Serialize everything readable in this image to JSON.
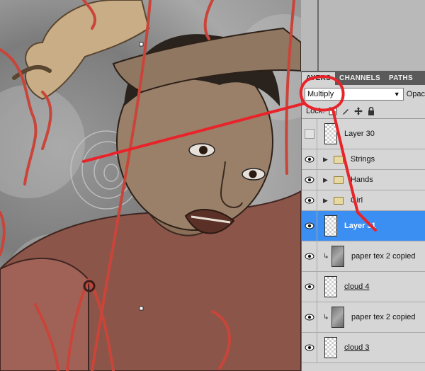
{
  "panel": {
    "tabs": [
      {
        "label": "AYERS",
        "active": true
      },
      {
        "label": "CHANNELS",
        "active": false
      },
      {
        "label": "PATHS",
        "active": false
      }
    ],
    "blend_mode": "Multiply",
    "opacity_label": "Opac",
    "lock_label": "Lock:",
    "layers": [
      {
        "name": "Layer 30",
        "visible": false,
        "kind": "layer"
      },
      {
        "name": "Strings",
        "visible": true,
        "kind": "group"
      },
      {
        "name": "Hands",
        "visible": true,
        "kind": "group"
      },
      {
        "name": "Girl",
        "visible": true,
        "kind": "group"
      },
      {
        "name": "Layer 31",
        "visible": true,
        "kind": "layer",
        "selected": true
      },
      {
        "name": "paper tex 2 copied",
        "visible": true,
        "kind": "clipped"
      },
      {
        "name": "cloud 4",
        "visible": true,
        "kind": "layer"
      },
      {
        "name": "paper tex 2 copied",
        "visible": true,
        "kind": "clipped"
      },
      {
        "name": "cloud 3",
        "visible": true,
        "kind": "layer"
      }
    ]
  },
  "colors": {
    "selection": "#3b8ff2",
    "annotation": "#e8232a",
    "string": "#c9453a"
  }
}
